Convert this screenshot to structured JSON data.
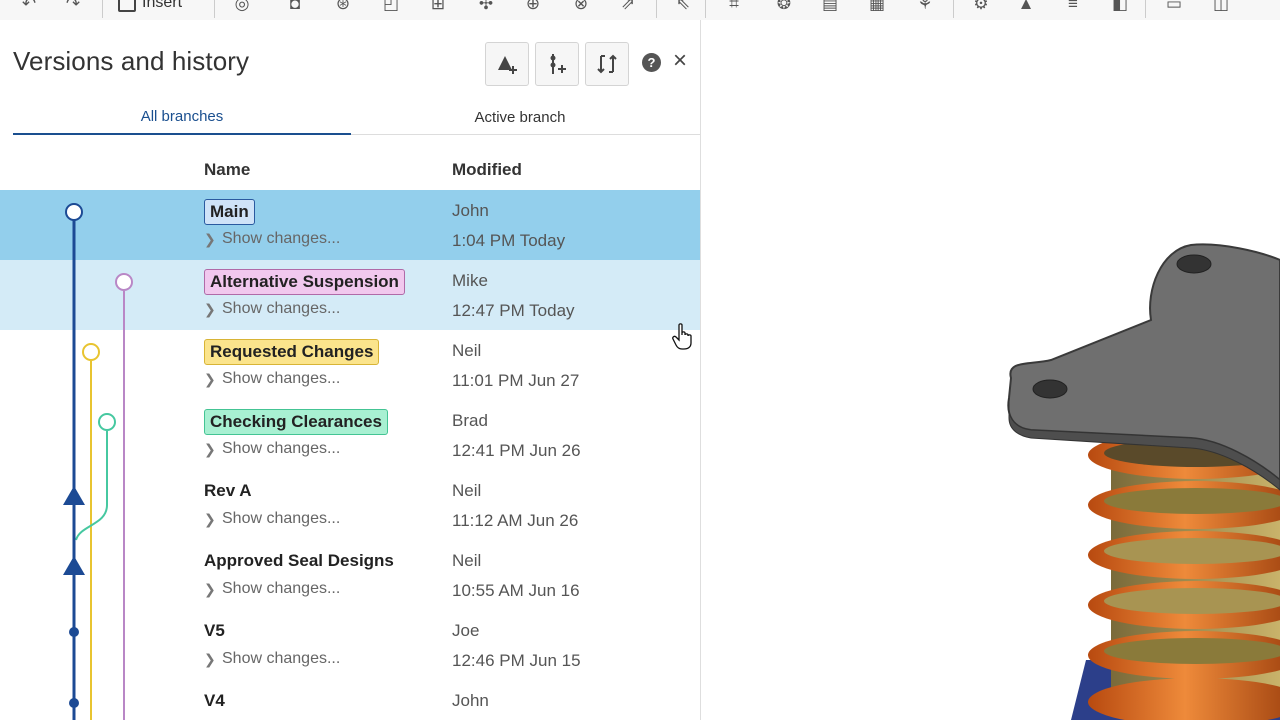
{
  "toolbar": {
    "insert_label": "Insert",
    "icons": [
      "undo-icon",
      "redo-icon",
      "revolve-icon",
      "shell-icon",
      "hole-icon",
      "fillet-icon",
      "extrude-icon",
      "pattern-icon",
      "mirror-icon",
      "sweep-icon",
      "loft-icon",
      "sketch-icon",
      "plane-icon",
      "assembly-icon",
      "mate-icon",
      "gear-icon",
      "transform-icon",
      "measure-icon",
      "export-icon",
      "more-icon"
    ]
  },
  "panel": {
    "title": "Versions and history",
    "header_buttons": [
      "create-version-icon",
      "create-branch-icon",
      "compare-icon"
    ],
    "help_glyph": "?",
    "close_glyph": "×"
  },
  "tabs": [
    {
      "label": "All branches",
      "active": true
    },
    {
      "label": "Active branch",
      "active": false
    }
  ],
  "columns": {
    "name": "Name",
    "modified": "Modified"
  },
  "show_changes_label": "Show changes...",
  "rows": [
    {
      "name": "Main",
      "user": "John",
      "time": "1:04 PM Today",
      "tag_color": "#cfe3f8",
      "tag_border": "#2a5aa0",
      "branch_color": "#1c4a94",
      "state": "selected"
    },
    {
      "name": "Alternative Suspension",
      "user": "Mike",
      "time": "12:47 PM Today",
      "tag_color": "#f1c8ee",
      "tag_border": "#b06aa8",
      "branch_color": "#b987c6",
      "state": "hover"
    },
    {
      "name": "Requested Changes",
      "user": "Neil",
      "time": "11:01 PM Jun 27",
      "tag_color": "#fbe48c",
      "tag_border": "#d8b436",
      "branch_color": "#e8c430",
      "state": ""
    },
    {
      "name": "Checking Clearances",
      "user": "Brad",
      "time": "12:41 PM Jun 26",
      "tag_color": "#a8f0d2",
      "tag_border": "#44c494",
      "branch_color": "#46c8a0",
      "state": ""
    },
    {
      "name": "Rev A",
      "user": "Neil",
      "time": "11:12 AM Jun 26",
      "tag_color": "",
      "tag_border": "",
      "branch_color": "#1c4a94",
      "state": ""
    },
    {
      "name": "Approved Seal Designs",
      "user": "Neil",
      "time": "10:55 AM Jun 16",
      "tag_color": "",
      "tag_border": "",
      "branch_color": "#1c4a94",
      "state": ""
    },
    {
      "name": "V5",
      "user": "Joe",
      "time": "12:46 PM Jun 15",
      "tag_color": "",
      "tag_border": "",
      "branch_color": "#1c4a94",
      "state": ""
    },
    {
      "name": "V4",
      "user": "John",
      "time": "",
      "tag_color": "",
      "tag_border": "",
      "branch_color": "#1c4a94",
      "state": ""
    }
  ],
  "colors": {
    "main_branch": "#1c4a94",
    "selected_row": "#93cfec",
    "hover_row": "#d4ebf7",
    "spring": "#d9641c",
    "bracket": "#6b6b6b"
  }
}
